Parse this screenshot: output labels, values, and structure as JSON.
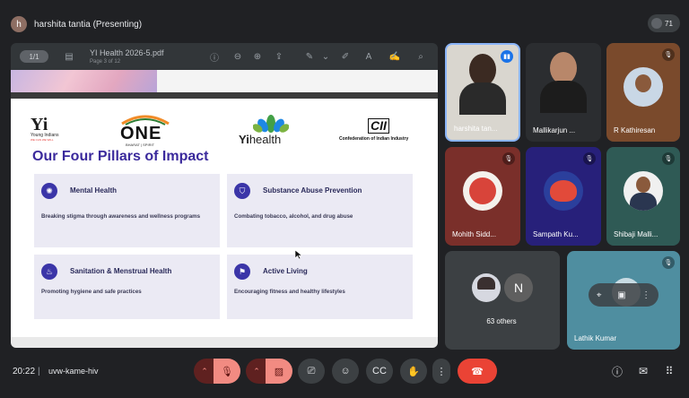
{
  "topbar": {
    "presenter_initial": "h",
    "presenter_label": "harshita tantia (Presenting)",
    "participants_count": "71"
  },
  "pdf": {
    "title": "YI Health 2026-5.pdf",
    "page_label": "Page 3 of 12",
    "zoom_label": "1/1"
  },
  "slide": {
    "logos": {
      "yi_mark": "Yi",
      "yi_text": "Young Indians",
      "yi_tagline": "WE CAN WE WILL",
      "one_text": "ONE",
      "one_sub": "BHARAT | SPIRIT",
      "health_prefix": "Yi",
      "health_text": "health",
      "cii_text": "CII",
      "cii_sub": "Confederation of Indian Industry"
    },
    "heading": "Our Four Pillars of Impact",
    "pillars": [
      {
        "icon": "brain-icon",
        "title": "Mental Health",
        "desc": "Breaking stigma through awareness and wellness programs"
      },
      {
        "icon": "shield-icon",
        "title": "Substance Abuse Prevention",
        "desc": "Combating tobacco, alcohol, and drug abuse"
      },
      {
        "icon": "droplet-icon",
        "title": "Sanitation & Menstrual Health",
        "desc": "Promoting hygiene and safe practices"
      },
      {
        "icon": "running-icon",
        "title": "Active Living",
        "desc": "Encouraging fitness and healthy lifestyles"
      }
    ]
  },
  "participants": [
    {
      "name": "harshita tan...",
      "status": "speaking"
    },
    {
      "name": "Mallikarjun ...",
      "status": "on"
    },
    {
      "name": "R Kathiresan",
      "status": "muted"
    },
    {
      "name": "Mohith Sidd...",
      "status": "muted"
    },
    {
      "name": "Sampath Ku...",
      "status": "muted"
    },
    {
      "name": "Shibaji Malli...",
      "status": "muted"
    },
    {
      "name": "Lathik Kumar",
      "status": "muted"
    }
  ],
  "others": {
    "initial": "N",
    "label": "63 others"
  },
  "bottombar": {
    "time": "20:22",
    "separator": "|",
    "meeting_code": "uvw-kame-hiv"
  },
  "colors": {
    "accent": "#3b2a9c",
    "card_bg": "#ebeaf4",
    "mute_red": "#f28b82",
    "hangup": "#ea4335"
  }
}
